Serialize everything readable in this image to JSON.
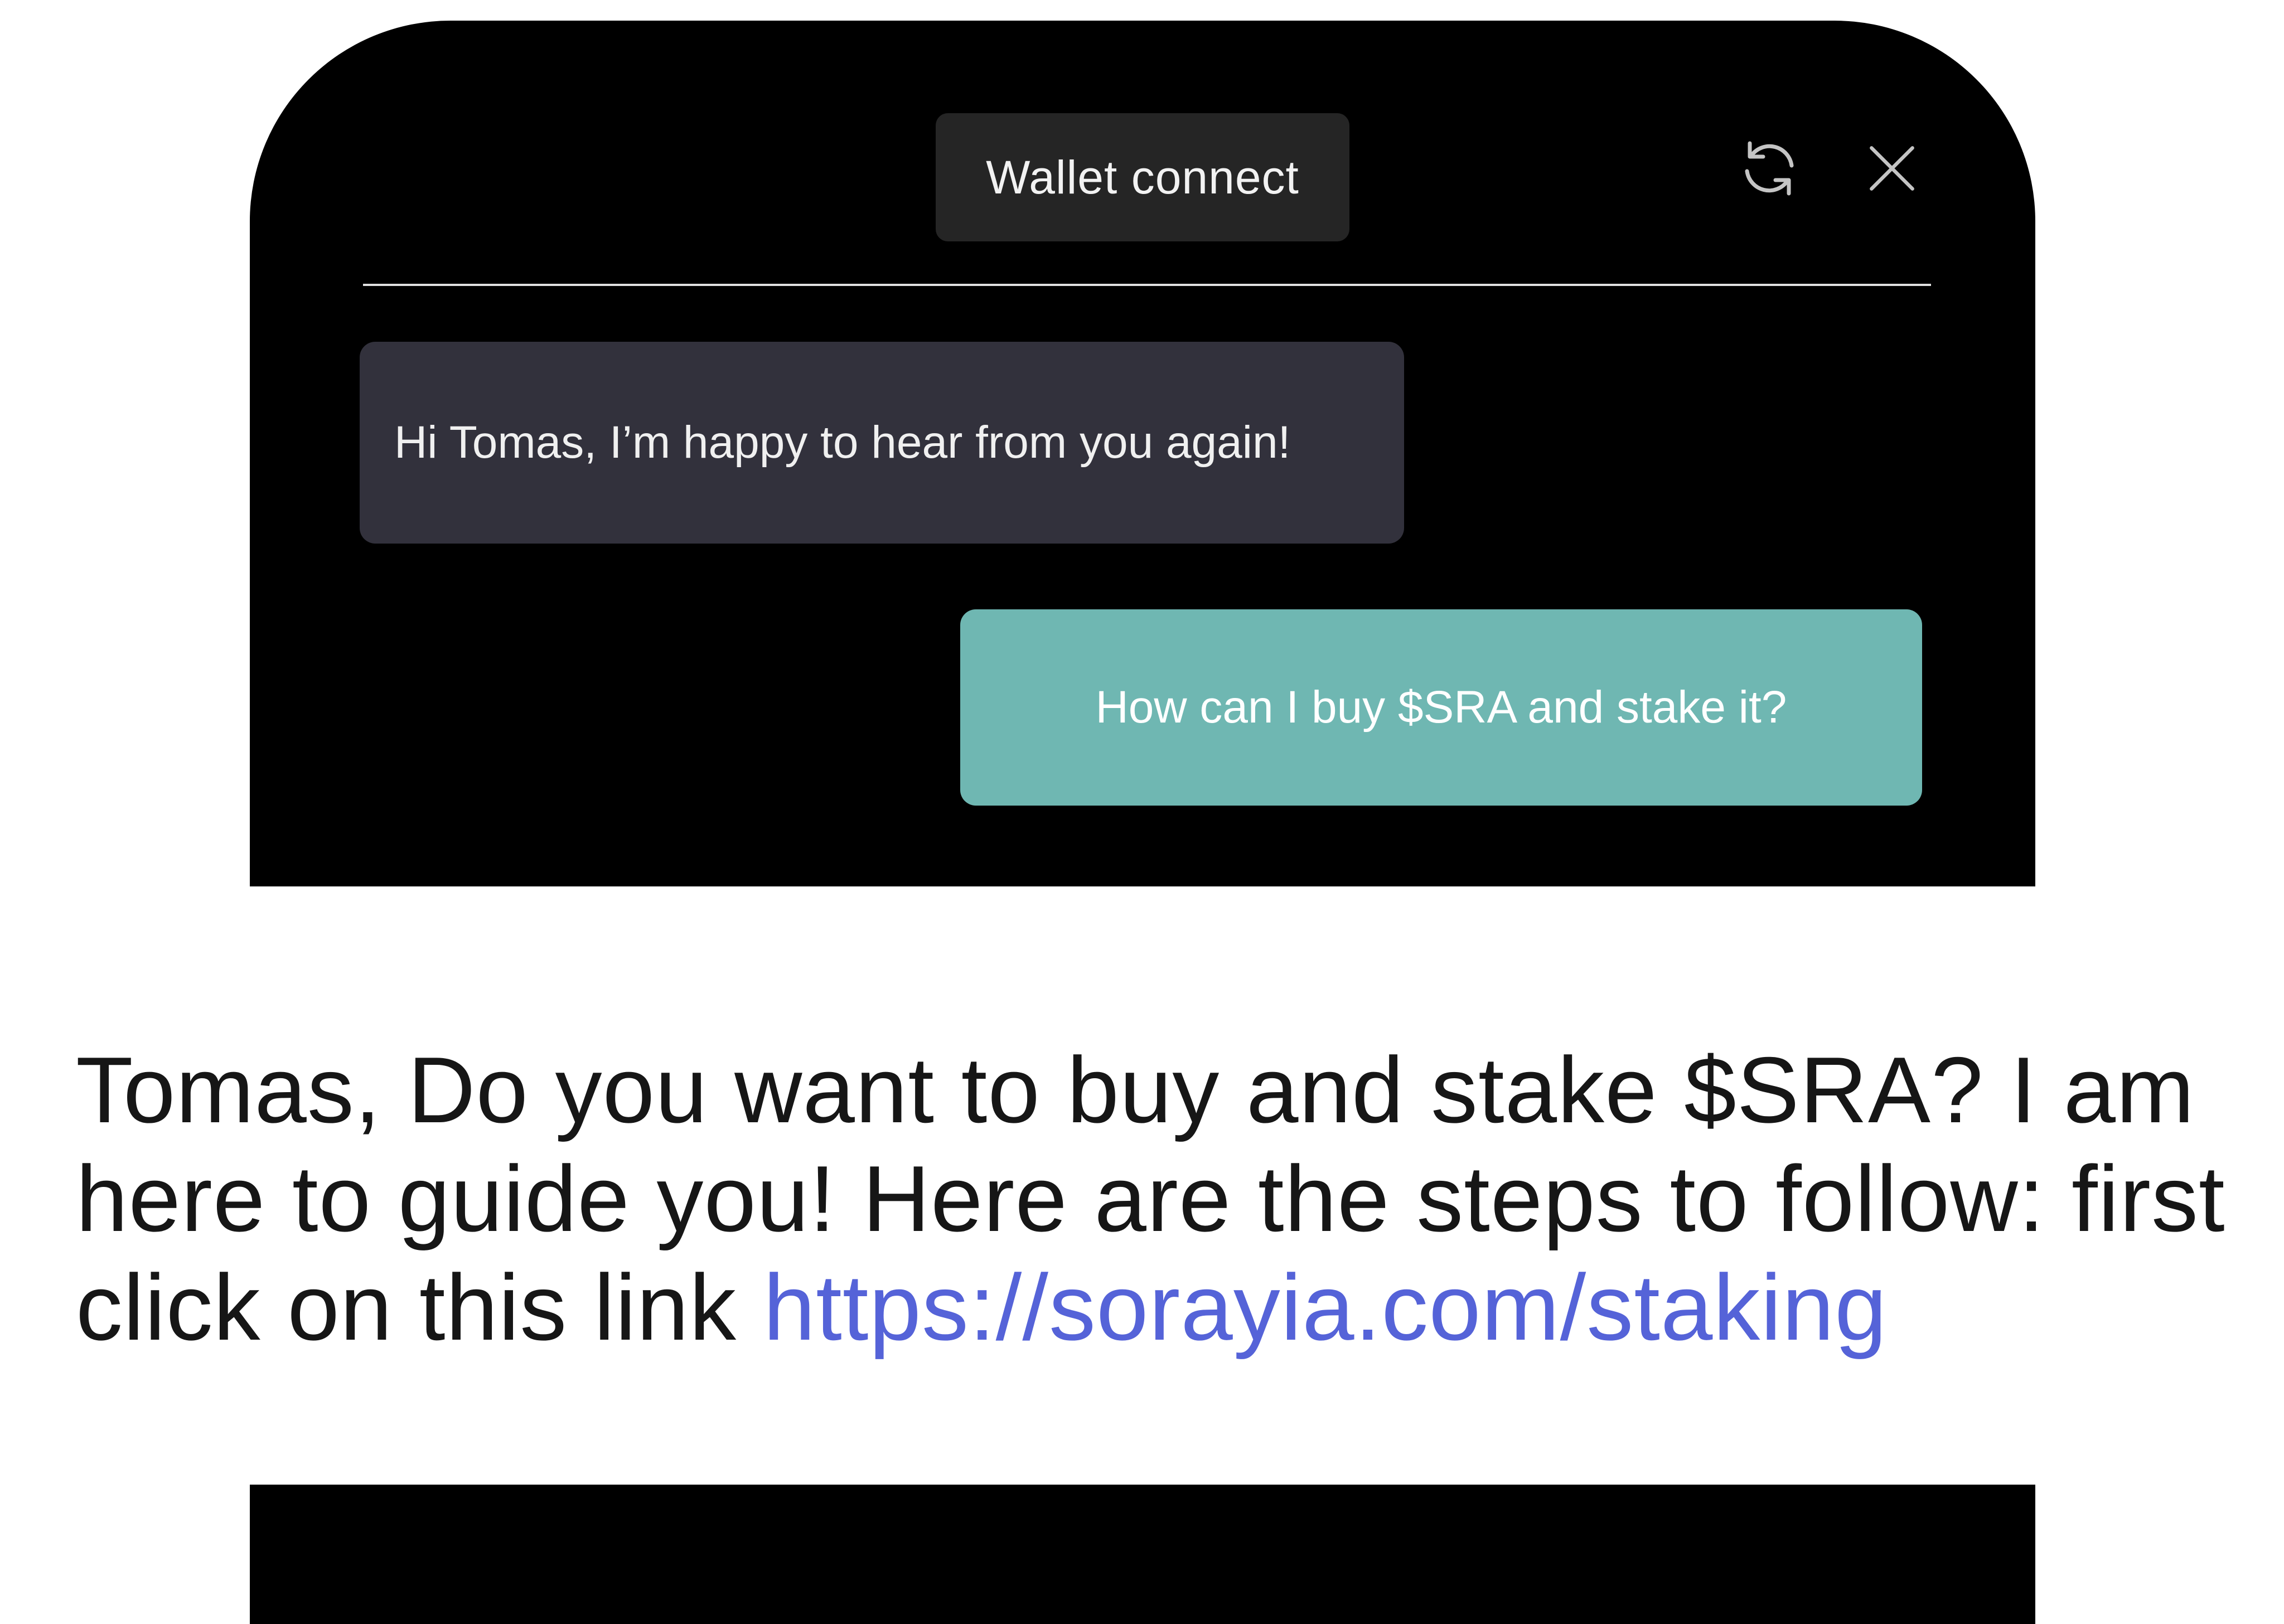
{
  "chat": {
    "wallet_button": "Wallet connect",
    "refresh_icon": "refresh-icon",
    "close_icon": "close-icon",
    "messages": [
      {
        "sender": "bot",
        "text": "Hi Tomas, I’m happy to hear from you again!"
      },
      {
        "sender": "user",
        "text": "How can I buy $SRA and stake it?"
      }
    ]
  },
  "reply": {
    "text": "Tomas, Do you want to buy and stake $SRA? I am here to guide you! Here are the steps to follow: first click on this link ",
    "link": "https://sorayia.com/staking"
  },
  "colors": {
    "background": "#ffffff",
    "phone": "#000000",
    "wallet_button": "#252525",
    "bot_bubble": "#32313c",
    "user_bubble": "#6fb7b2",
    "link": "#5563d8",
    "text": "#161616"
  }
}
